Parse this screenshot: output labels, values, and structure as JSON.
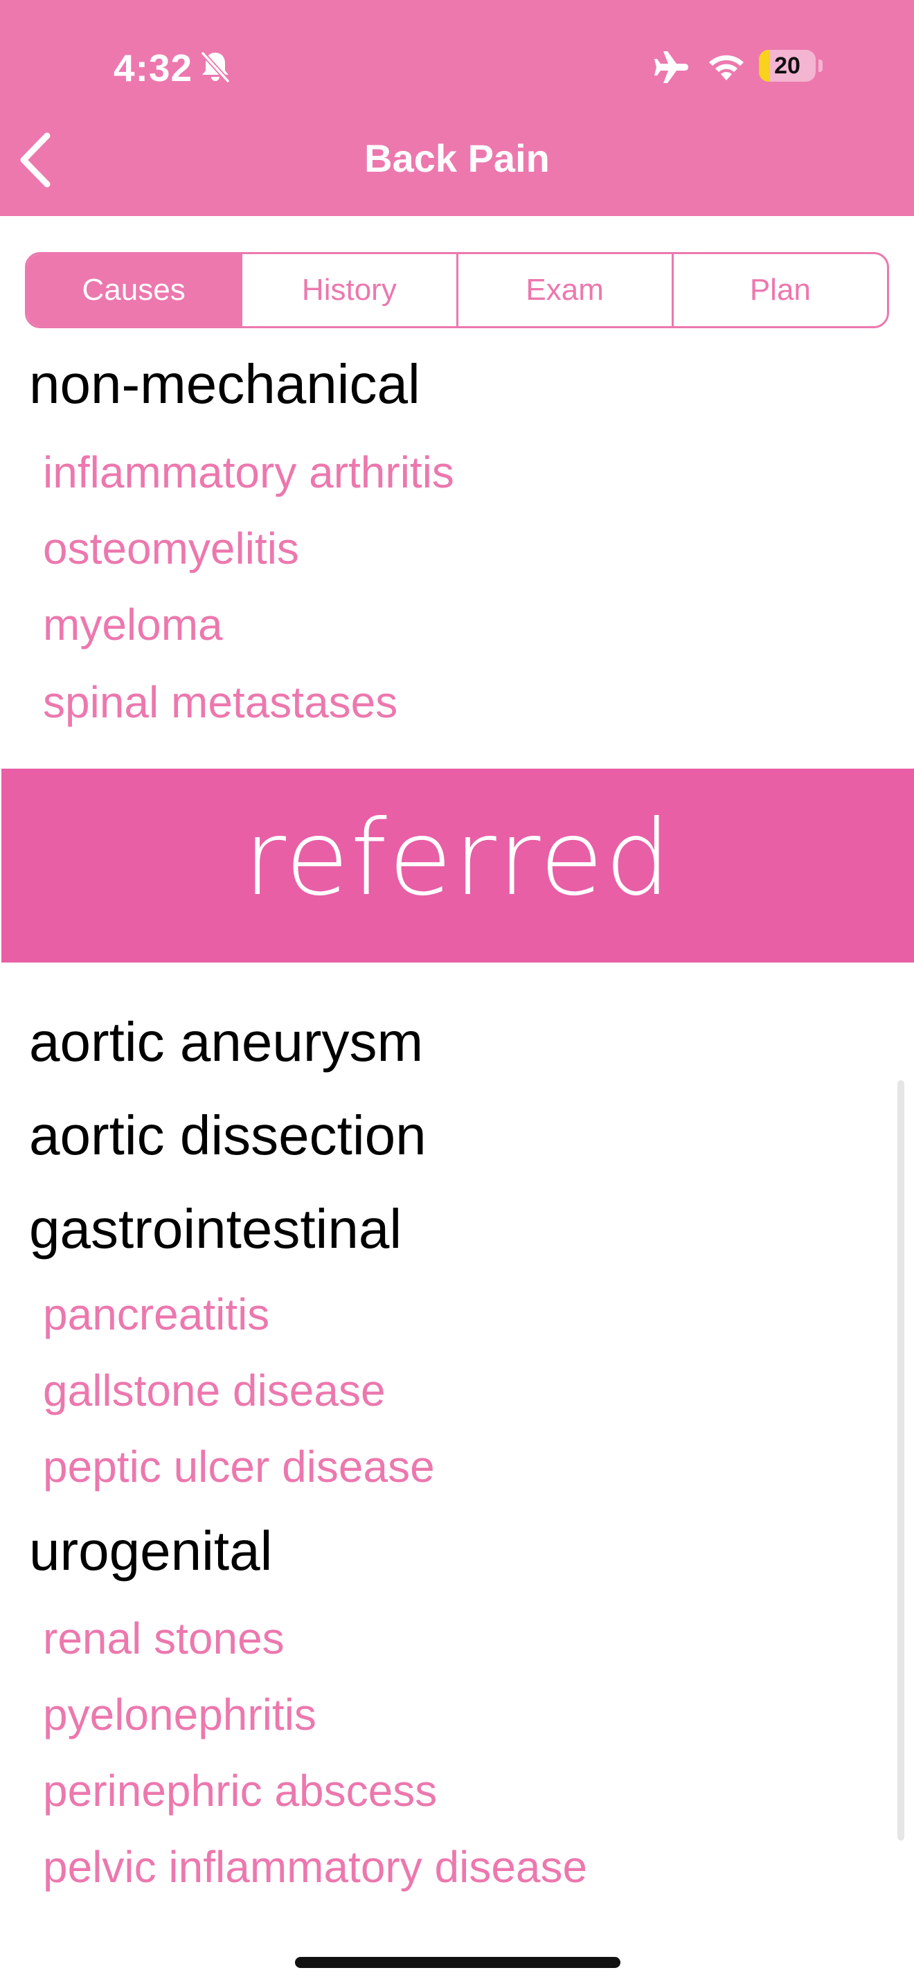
{
  "status_bar": {
    "time": "4:32",
    "battery_level": "20",
    "battery_fraction": 0.2,
    "icons": [
      "bell-slash-icon",
      "airplane-icon",
      "wifi-icon",
      "battery-icon"
    ]
  },
  "nav": {
    "title": "Back Pain",
    "back_icon": "chevron-left-icon"
  },
  "colors": {
    "header": "#ec78ae",
    "accent": "#ec78ae",
    "banner": "#e85fa6",
    "heading_text": "#000000"
  },
  "tabs": [
    {
      "label": "Causes",
      "selected": true
    },
    {
      "label": "History",
      "selected": false
    },
    {
      "label": "Exam",
      "selected": false
    },
    {
      "label": "Plan",
      "selected": false
    }
  ],
  "sections": {
    "non_mechanical": {
      "heading": "non-mechanical",
      "items": [
        "inflammatory arthritis",
        "osteomyelitis",
        "myeloma",
        "spinal metastases"
      ]
    },
    "referred_banner": "referred",
    "aortic_aneurysm": "aortic aneurysm",
    "aortic_dissection": "aortic dissection",
    "gastrointestinal": {
      "heading": "gastrointestinal",
      "items": [
        "pancreatitis",
        "gallstone disease",
        "peptic ulcer disease"
      ]
    },
    "urogenital": {
      "heading": "urogenital",
      "items": [
        "renal stones",
        "pyelonephritis",
        "perinephric abscess",
        "pelvic inflammatory disease"
      ]
    }
  }
}
